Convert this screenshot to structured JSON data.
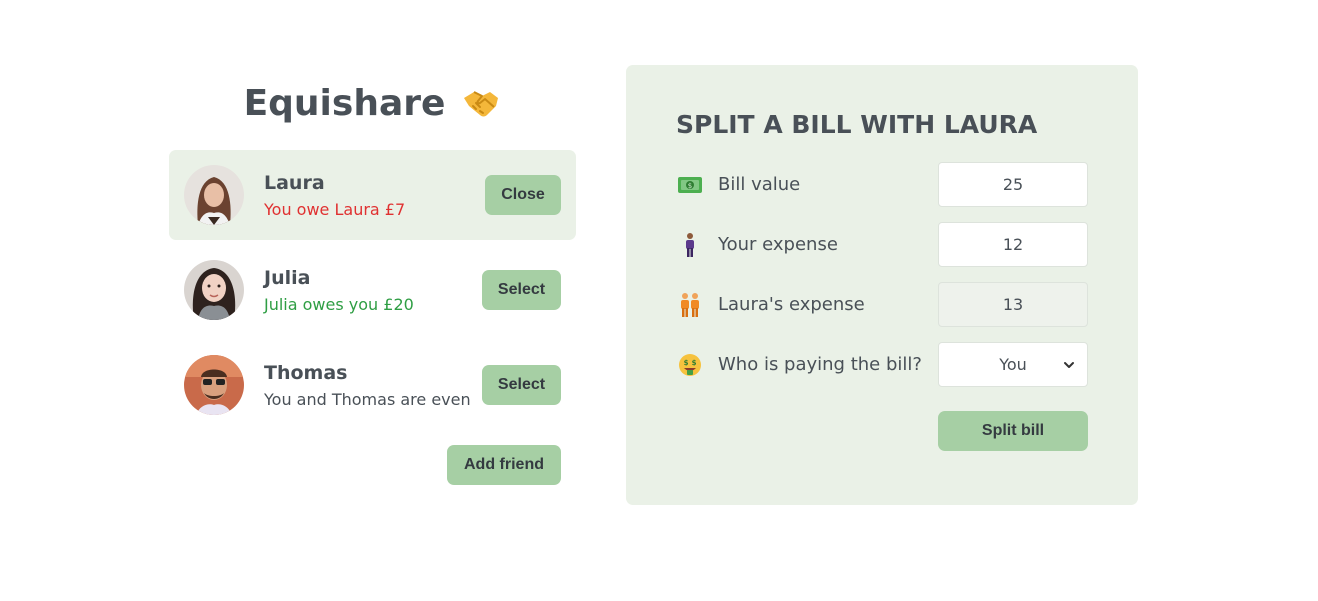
{
  "app": {
    "title": "Equishare",
    "title_icon": "handshake-icon"
  },
  "friends": [
    {
      "name": "Laura",
      "status": "You owe Laura £7",
      "status_type": "owe",
      "button": "Close",
      "selected": true
    },
    {
      "name": "Julia",
      "status": "Julia owes you £20",
      "status_type": "owed",
      "button": "Select",
      "selected": false
    },
    {
      "name": "Thomas",
      "status": "You and Thomas are even",
      "status_type": "even",
      "button": "Select",
      "selected": false
    }
  ],
  "add_friend_label": "Add friend",
  "form": {
    "title": "SPLIT A BILL WITH LAURA",
    "bill": {
      "icon": "money-icon",
      "label": "Bill value",
      "value": "25"
    },
    "your_expense": {
      "icon": "person-icon",
      "label": "Your expense",
      "value": "12"
    },
    "friend_expense": {
      "icon": "two-people-icon",
      "label": "Laura's expense",
      "value": "13"
    },
    "payer": {
      "icon": "money-face-icon",
      "label": "Who is paying the bill?",
      "value": "You"
    },
    "submit_label": "Split bill"
  },
  "colors": {
    "accent": "#a6cfa4",
    "panel_bg": "#eaf1e7",
    "text": "#495057",
    "owe": "#e03131",
    "owed": "#2f9e44"
  }
}
